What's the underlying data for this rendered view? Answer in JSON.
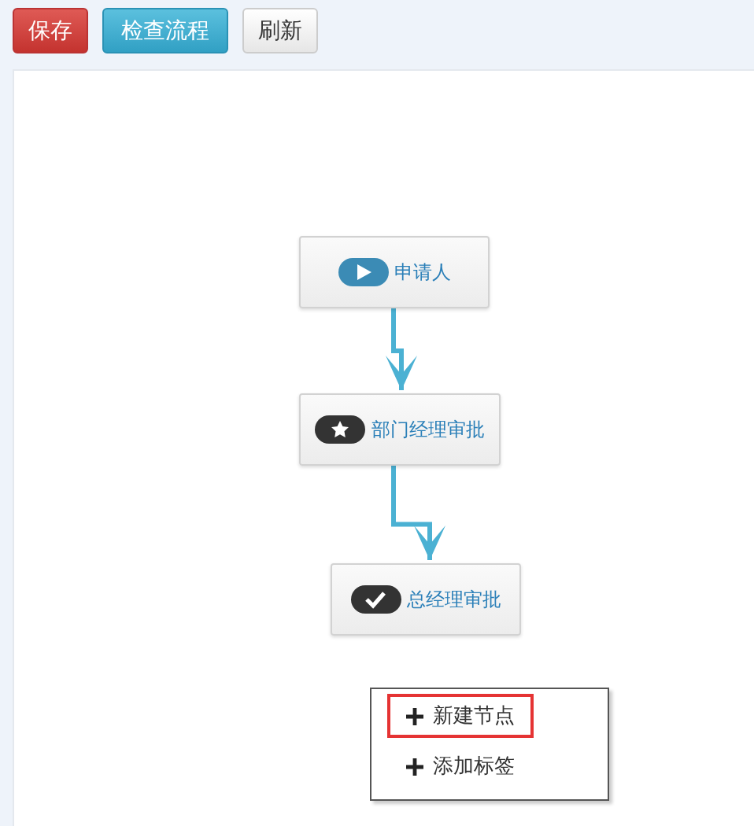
{
  "toolbar": [
    {
      "label": "保存",
      "kind": "danger"
    },
    {
      "label": "检查流程",
      "kind": "info"
    },
    {
      "label": "刷新",
      "kind": "default"
    }
  ],
  "nodes": [
    {
      "label": "申请人",
      "kind": "start"
    },
    {
      "label": "部门经理审批",
      "kind": "star"
    },
    {
      "label": "总经理审批",
      "kind": "check"
    }
  ],
  "context_menu": [
    {
      "label": "新建节点",
      "selected": true
    },
    {
      "label": "添加标签",
      "selected": false
    }
  ]
}
